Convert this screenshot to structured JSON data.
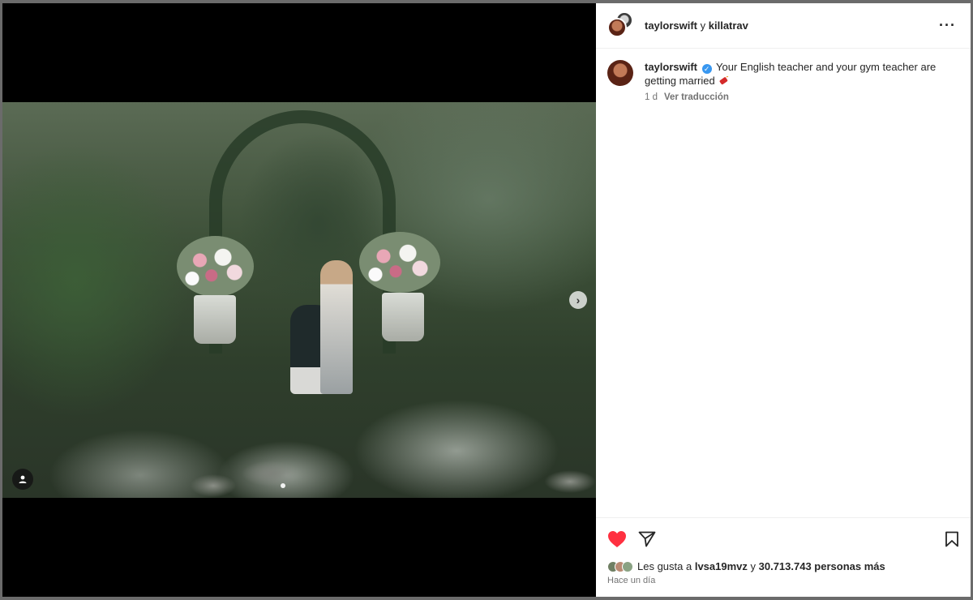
{
  "header": {
    "user1": "taylorswift",
    "connector": " y ",
    "user2": "killatrav",
    "more_icon": "more-horizontal-icon"
  },
  "caption": {
    "username": "taylorswift",
    "text": " Your English teacher and your gym teacher are getting married",
    "time_ago": "1 d",
    "translate_label": "Ver traducción"
  },
  "actions": {
    "like_icon": "heart-filled-icon",
    "share_icon": "send-icon",
    "save_icon": "bookmark-icon",
    "like_color": "#ff3040"
  },
  "likes": {
    "prefix": "Les gusta a ",
    "first_user": "lvsa19mvz",
    "connector": " y ",
    "count": "30.713.743 personas más"
  },
  "timestamp": "Hace un día"
}
